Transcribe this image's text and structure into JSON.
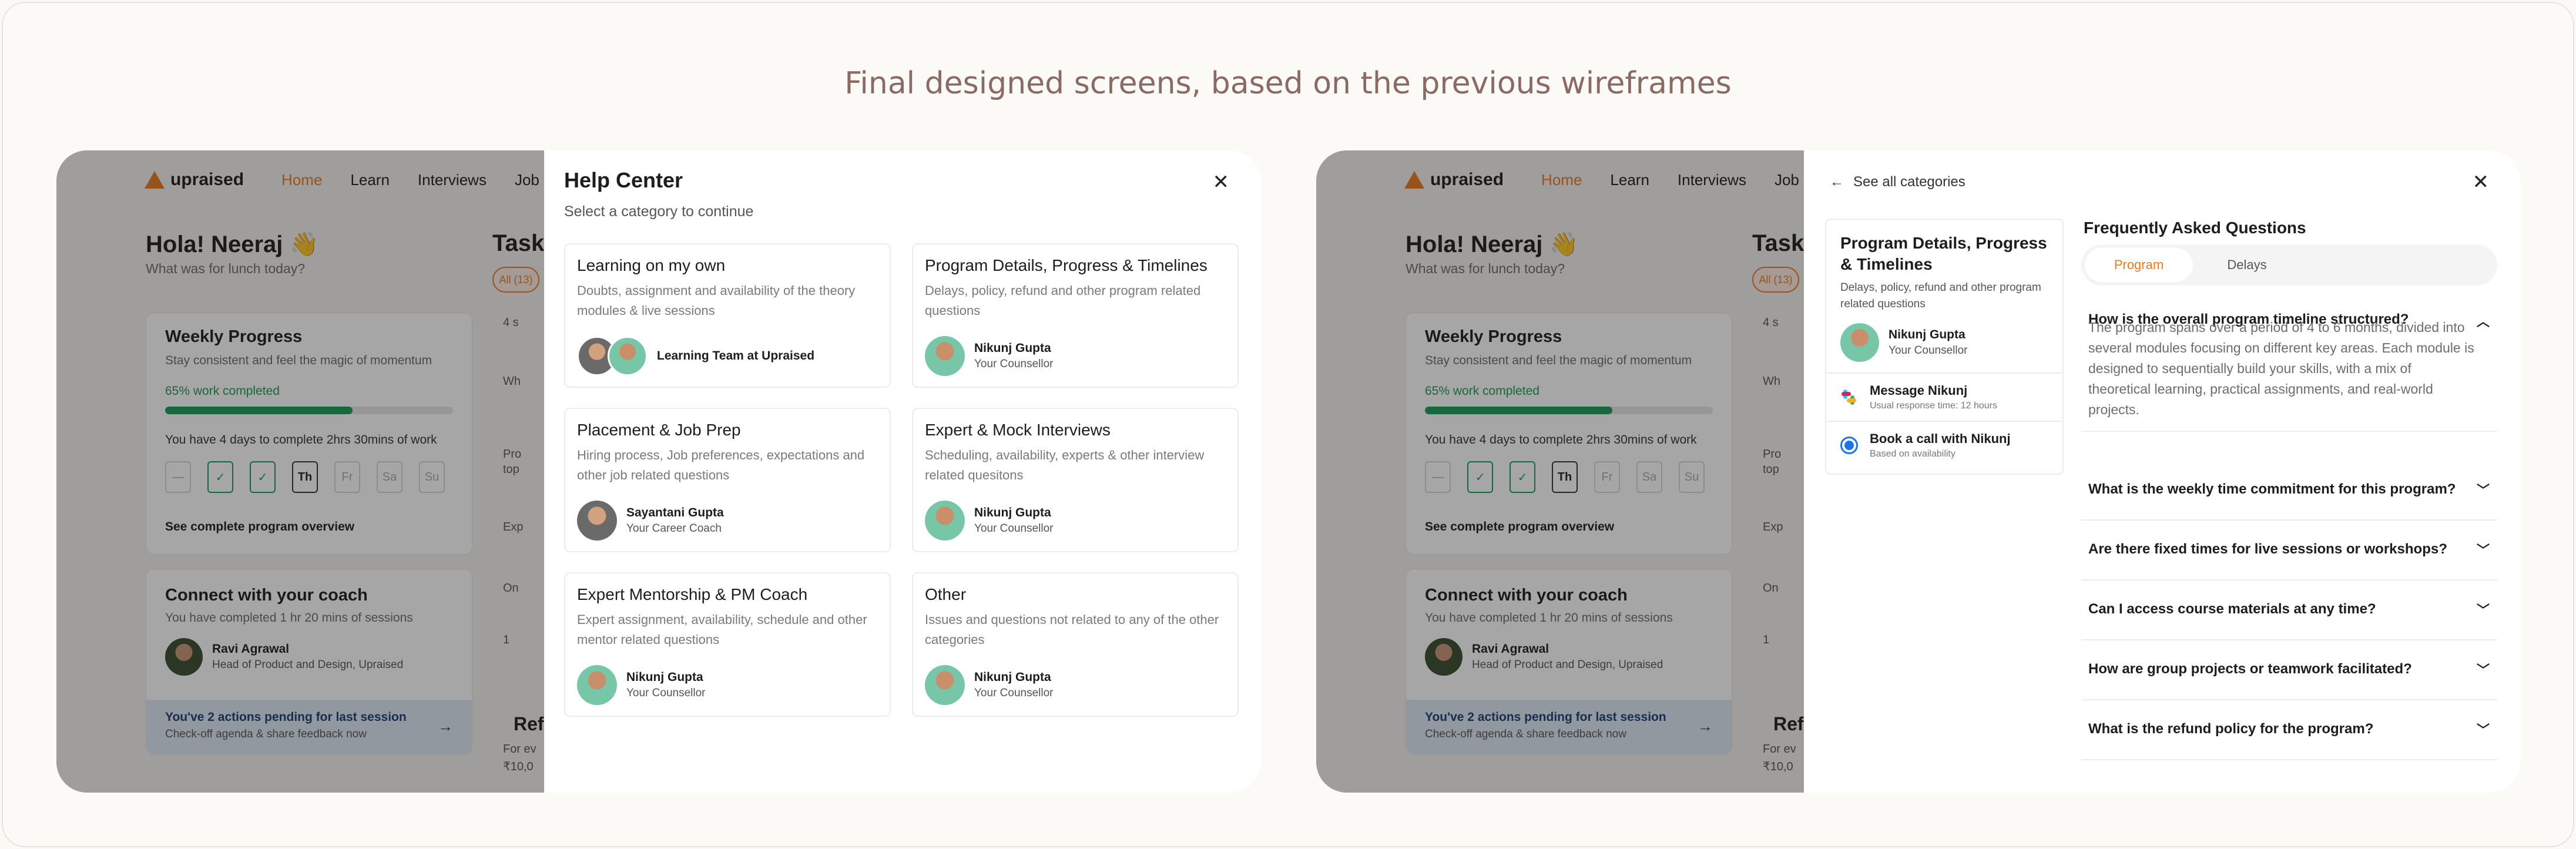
{
  "headline": "Final designed screens, based on the previous wireframes",
  "app": {
    "logo": "upraised",
    "nav": [
      "Home",
      "Learn",
      "Interviews",
      "Job"
    ],
    "greeting": "Hola! Neeraj 👋",
    "subtitle": "What was for lunch today?",
    "weekly": {
      "title": "Weekly Progress",
      "subtitle": "Stay consistent and feel the magic of momentum",
      "completed_label": "65% work completed",
      "progress": 0.65,
      "days_text": "You have 4 days to complete 2hrs 30mins of work",
      "days": [
        "—",
        "✓",
        "✓",
        "Th",
        "Fr",
        "Sa",
        "Su"
      ],
      "link": "See complete program overview"
    },
    "coach": {
      "title": "Connect with your coach",
      "subtitle": "You have completed 1 hr 20 mins of sessions",
      "name": "Ravi Agrawal",
      "role": "Head of Product and Design, Upraised",
      "pending_title": "You've 2 actions pending for last session",
      "pending_sub": "Check-off agenda & share feedback now"
    },
    "tasks": {
      "title": "Tasks",
      "pill": "All (13)",
      "row1": "4 s",
      "row2": "Wh",
      "row3a": "Pro",
      "row3b": "top",
      "row4": "Exp",
      "row5": "On",
      "page": "1",
      "ref_title": "Refe",
      "ref_line1": "For ev",
      "ref_line2": "₹10,0"
    }
  },
  "help": {
    "title": "Help Center",
    "subtitle": "Select a category to continue",
    "categories": [
      {
        "title": "Learning on my own",
        "desc": "Doubts, assignment and availability of the theory modules & live sessions",
        "name": "Learning Team at Upraised",
        "role": ""
      },
      {
        "title": "Program Details, Progress & Timelines",
        "desc": "Delays, policy, refund and other program related questions",
        "name": "Nikunj Gupta",
        "role": "Your Counsellor"
      },
      {
        "title": "Placement & Job Prep",
        "desc": "Hiring process, Job preferences, expectations and other job related questions",
        "name": "Sayantani  Gupta",
        "role": "Your Career Coach"
      },
      {
        "title": "Expert & Mock Interviews",
        "desc": "Scheduling, availability, experts & other interview related quesitons",
        "name": "Nikunj Gupta",
        "role": "Your Counsellor"
      },
      {
        "title": "Expert Mentorship & PM Coach",
        "desc": "Expert assignment, availability, schedule and other mentor related questions",
        "name": "Nikunj Gupta",
        "role": "Your Counsellor"
      },
      {
        "title": "Other",
        "desc": "Issues and questions not related to any of the other categories",
        "name": "Nikunj Gupta",
        "role": "Your Counsellor"
      }
    ]
  },
  "faq": {
    "back": "See all categories",
    "side_title": "Program Details, Progress & Timelines",
    "side_desc": "Delays, policy, refund and other program related questions",
    "counsellor_name": "Nikunj Gupta",
    "counsellor_role": "Your Counsellor",
    "message_title": "Message Nikunj",
    "message_sub": "Usual response time: 12 hours",
    "call_title": "Book a call with Nikunj",
    "call_sub": "Based on availability",
    "title": "Frequently Asked Questions",
    "tabs": [
      "Program",
      "Delays"
    ],
    "questions": [
      {
        "q": "How is the overall program timeline structured?",
        "a": "The program spans over a period of 4 to 6 months, divided into several modules focusing on different key areas. Each module is designed to sequentially build your skills, with a mix of theoretical learning, practical assignments, and real-world projects."
      },
      {
        "q": "What is the weekly time commitment for this program?",
        "a": ""
      },
      {
        "q": "Are there fixed times for live sessions or workshops?",
        "a": ""
      },
      {
        "q": "Can I access course materials at any time?",
        "a": ""
      },
      {
        "q": "How are group projects or teamwork facilitated?",
        "a": ""
      },
      {
        "q": "What is the refund policy for the program?",
        "a": ""
      }
    ]
  },
  "colors": {
    "accent": "#e87a22",
    "success": "#1a9c57",
    "info": "#1a73e8"
  },
  "icons": [
    "close-icon",
    "back-arrow-icon",
    "chevron-up-icon",
    "chevron-down-icon",
    "slack-icon",
    "radio-icon",
    "arrow-right-icon",
    "logo-icon"
  ]
}
